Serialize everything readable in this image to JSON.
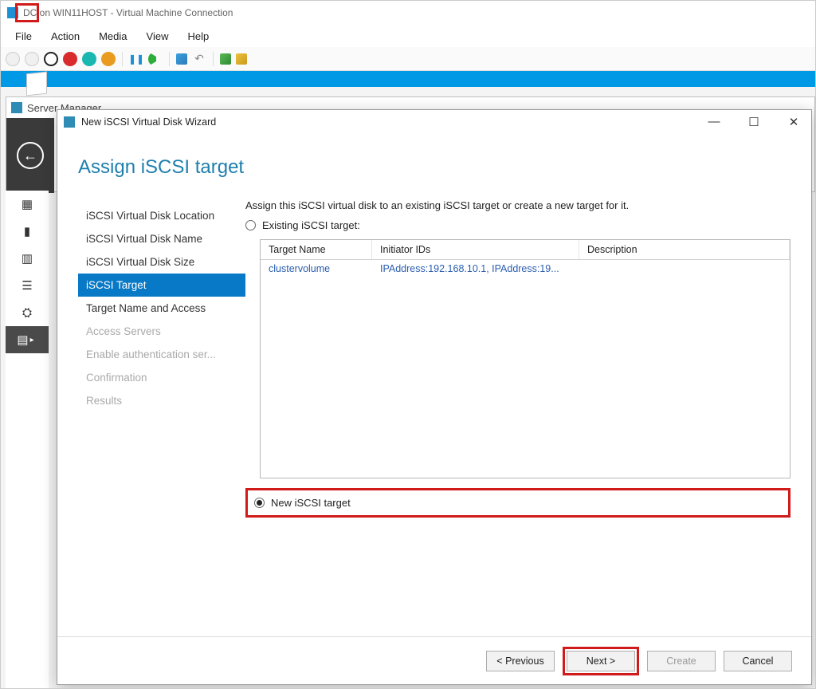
{
  "vm": {
    "title": "DC on WIN11HOST - Virtual Machine Connection",
    "menus": {
      "file": "File",
      "action": "Action",
      "media": "Media",
      "view": "View",
      "help": "Help"
    }
  },
  "server_manager": {
    "title": "Server Manager"
  },
  "wizard": {
    "title": "New iSCSI Virtual Disk Wizard",
    "heading": "Assign iSCSI target",
    "steps": {
      "location": "iSCSI Virtual Disk Location",
      "name": "iSCSI Virtual Disk Name",
      "size": "iSCSI Virtual Disk Size",
      "target": "iSCSI Target",
      "target_name": "Target Name and Access",
      "access_servers": "Access Servers",
      "auth": "Enable authentication ser...",
      "confirmation": "Confirmation",
      "results": "Results"
    },
    "intro": "Assign this iSCSI virtual disk to an existing iSCSI target or create a new target for it.",
    "existing_label": "Existing iSCSI target:",
    "new_label": "New iSCSI target",
    "columns": {
      "target_name": "Target Name",
      "initiator_ids": "Initiator IDs",
      "description": "Description"
    },
    "rows": [
      {
        "target_name": "clustervolume",
        "initiator_ids": "IPAddress:192.168.10.1, IPAddress:19...",
        "description": ""
      }
    ],
    "buttons": {
      "previous": "< Previous",
      "next": "Next >",
      "create": "Create",
      "cancel": "Cancel"
    },
    "window_controls": {
      "min": "—",
      "max": "☐",
      "close": "✕"
    }
  }
}
